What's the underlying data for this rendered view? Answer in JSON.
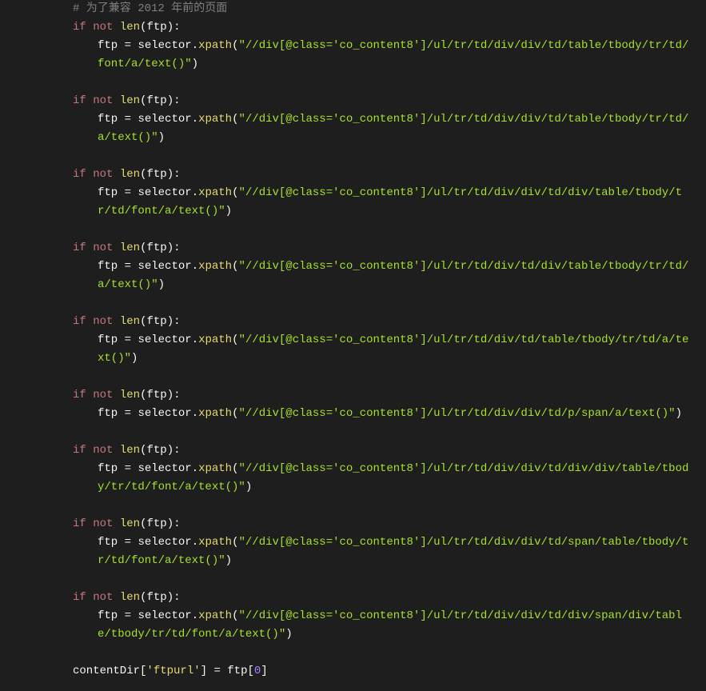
{
  "code": {
    "comment1": "# 为了兼容 2012 年前的页面",
    "if": "if",
    "not": "not",
    "lenftp_open": "len",
    "ftp_id": "ftp",
    "ftp_assign": "ftp = selector.xpath(",
    "xpath_fn": "xpath",
    "selector_id": "selector",
    "assign_op": " = ",
    "dot": ".",
    "lparen": "(",
    "rparen": ")",
    "colon": ":",
    "xpath1": "\"//div[@class='co_content8']/ul/tr/td/div/div/td/table/tbody/tr/td/font/a/text()\"",
    "xpath2": "\"//div[@class='co_content8']/ul/tr/td/div/div/td/table/tbody/tr/td/a/text()\"",
    "xpath3": "\"//div[@class='co_content8']/ul/tr/td/div/div/td/div/table/tbody/tr/td/font/a/text()\"",
    "xpath4": "\"//div[@class='co_content8']/ul/tr/td/div/td/div/table/tbody/tr/td/a/text()\"",
    "xpath5": "\"//div[@class='co_content8']/ul/tr/td/div/td/table/tbody/tr/td/a/text()\"",
    "xpath6": "\"//div[@class='co_content8']/ul/tr/td/div/div/td/p/span/a/text()\"",
    "xpath7": "\"//div[@class='co_content8']/ul/tr/td/div/div/td/div/div/table/tbody/tr/td/font/a/text()\"",
    "xpath8": "\"//div[@class='co_content8']/ul/tr/td/div/div/td/span/table/tbody/tr/td/font/a/text()\"",
    "xpath9": "\"//div[@class='co_content8']/ul/tr/td/div/div/td/div/span/div/table/tbody/tr/td/font/a/text()\"",
    "contentDir": "contentDir",
    "lbracket": "[",
    "rbracket": "]",
    "ftpurl_key": "'ftpurl'",
    "zero": "0"
  }
}
